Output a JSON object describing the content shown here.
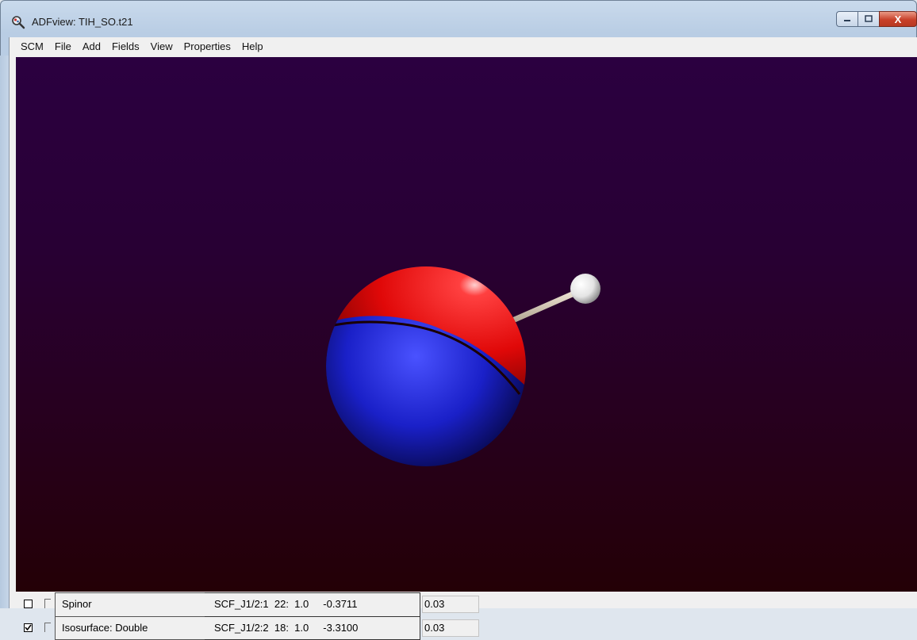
{
  "window": {
    "title": "ADFview: TIH_SO.t21",
    "controls": {
      "minimize_icon": "minimize-icon",
      "maximize_icon": "maximize-icon",
      "close_label": "X"
    }
  },
  "menubar": {
    "items": [
      "SCM",
      "File",
      "Add",
      "Fields",
      "View",
      "Properties",
      "Help"
    ]
  },
  "viewport": {
    "background_top": "#2b0040",
    "background_bottom": "#240006",
    "lobe_colors": {
      "positive": "#e01010",
      "negative": "#1a1fd0"
    },
    "atom_color": "#f2f2f2"
  },
  "fields": [
    {
      "visible": false,
      "name": "Spinor",
      "description": "SCF_J1/2:1  22:  1.0     -0.3711",
      "value": "0.03"
    },
    {
      "visible": true,
      "name": "Isosurface: Double",
      "description": "SCF_J1/2:2  18:  1.0     -3.3100",
      "value": "0.03"
    }
  ]
}
